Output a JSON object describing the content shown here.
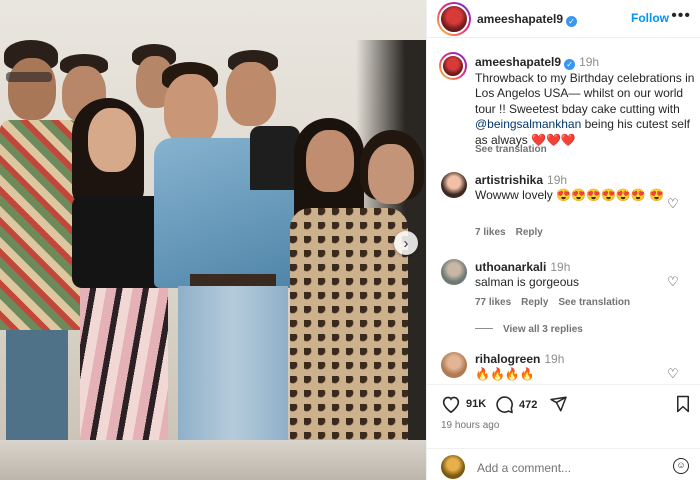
{
  "post": {
    "username": "ameeshapatel9",
    "follow_label": "Follow",
    "more_label": "•••",
    "caption_time": "19h",
    "caption_text": "Throwback to my Birthday celebrations in Los Angelos USA— whilst on our world tour !! Sweetest bday cake cutting with ",
    "caption_mention": "@beingsalmankhan",
    "caption_text_end": " being his cutest self as always ",
    "caption_hearts": "❤️❤️❤️",
    "see_translation": "See translation"
  },
  "comments": [
    {
      "username": "artistrishika",
      "time": "19h",
      "text": "Wowww lovely 😍😍😍😍😍😍 😍",
      "likes": "7 likes",
      "reply": "Reply",
      "see_translation": ""
    },
    {
      "username": "uthoanarkali",
      "time": "19h",
      "text": "salman is gorgeous",
      "likes": "77 likes",
      "reply": "Reply",
      "see_translation": "See translation"
    },
    {
      "username": "rihalogreen",
      "time": "19h",
      "text": "🔥🔥🔥🔥",
      "likes": "",
      "reply": "",
      "see_translation": ""
    }
  ],
  "view_all_replies": "View all 3 replies",
  "actions": {
    "likes_count": "91K",
    "comments_count": "472",
    "ago": "19 hours ago"
  },
  "add_comment_placeholder": "Add a comment...",
  "icons": [
    "verified-icon",
    "heart-icon",
    "comment-icon",
    "share-icon",
    "bookmark-icon",
    "emoji-icon",
    "next-arrow-icon"
  ],
  "colors": {
    "follow_blue": "#0095f6",
    "verified_blue": "#3897f0",
    "mention": "#00376b",
    "heart_red": "#ed1d24"
  }
}
